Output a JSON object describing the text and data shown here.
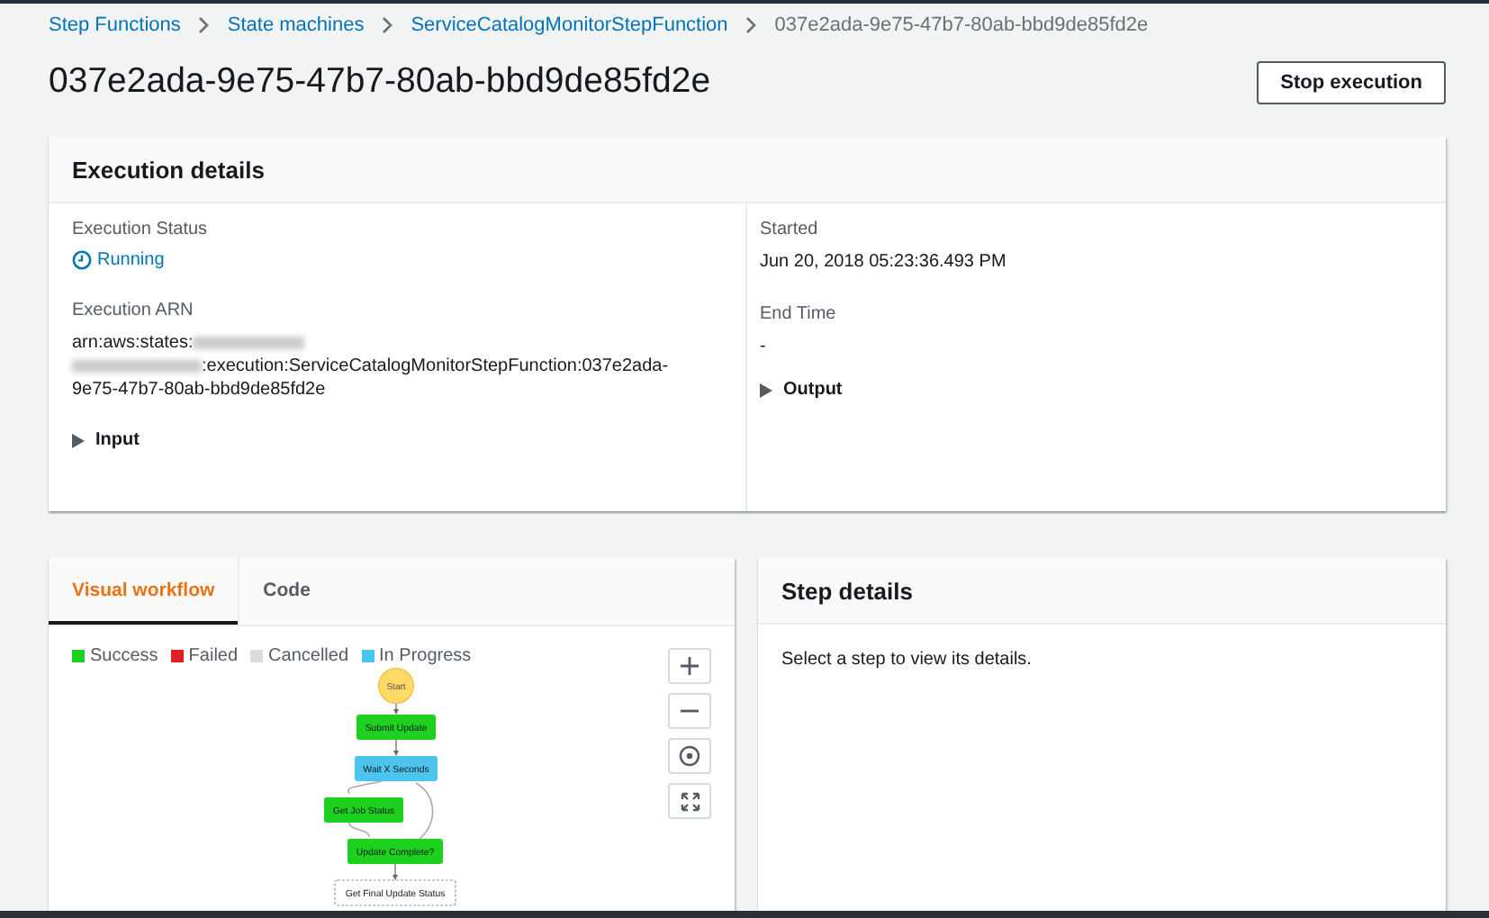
{
  "breadcrumbs": [
    {
      "label": "Step Functions",
      "link": true
    },
    {
      "label": "State machines",
      "link": true
    },
    {
      "label": "ServiceCatalogMonitorStepFunction",
      "link": true
    },
    {
      "label": "037e2ada-9e75-47b7-80ab-bbd9de85fd2e",
      "link": false
    }
  ],
  "title": "037e2ada-9e75-47b7-80ab-bbd9de85fd2e",
  "stop_button": "Stop execution",
  "execution_details": {
    "heading": "Execution details",
    "status_label": "Execution Status",
    "status": "Running",
    "arn_label": "Execution ARN",
    "arn_prefix": "arn:aws:states:",
    "arn_suffix": ":execution:ServiceCatalogMonitorStepFunction:037e2ada-",
    "arn_tail": "9e75-47b7-80ab-bbd9de85fd2e",
    "input": {
      "label": "Input",
      "expanded": false
    },
    "started_label": "Started",
    "started": "Jun 20, 2018 05:23:36.493 PM",
    "end_label": "End Time",
    "end": "-",
    "output": {
      "label": "Output",
      "expanded": false
    }
  },
  "workflow_tabs": [
    {
      "label": "Visual workflow",
      "selected": true
    },
    {
      "label": "Code",
      "selected": false
    }
  ],
  "legend": [
    {
      "label": "Success",
      "color": "#1fd11f"
    },
    {
      "label": "Failed",
      "color": "#e02020"
    },
    {
      "label": "Cancelled",
      "color": "#dcdcdc"
    },
    {
      "label": "In Progress",
      "color": "#4dc4ee"
    }
  ],
  "nodes": [
    {
      "label": "Start",
      "kind": "start"
    },
    {
      "label": "Submit Update",
      "kind": "success"
    },
    {
      "label": "Wait X Seconds",
      "kind": "in_progress"
    },
    {
      "label": "Get Job Status",
      "kind": "success"
    },
    {
      "label": "Update Complete?",
      "kind": "success"
    },
    {
      "label": "Get Final Update Status",
      "kind": "pending"
    }
  ],
  "step_details": {
    "heading": "Step details",
    "message": "Select a step to view its details."
  }
}
